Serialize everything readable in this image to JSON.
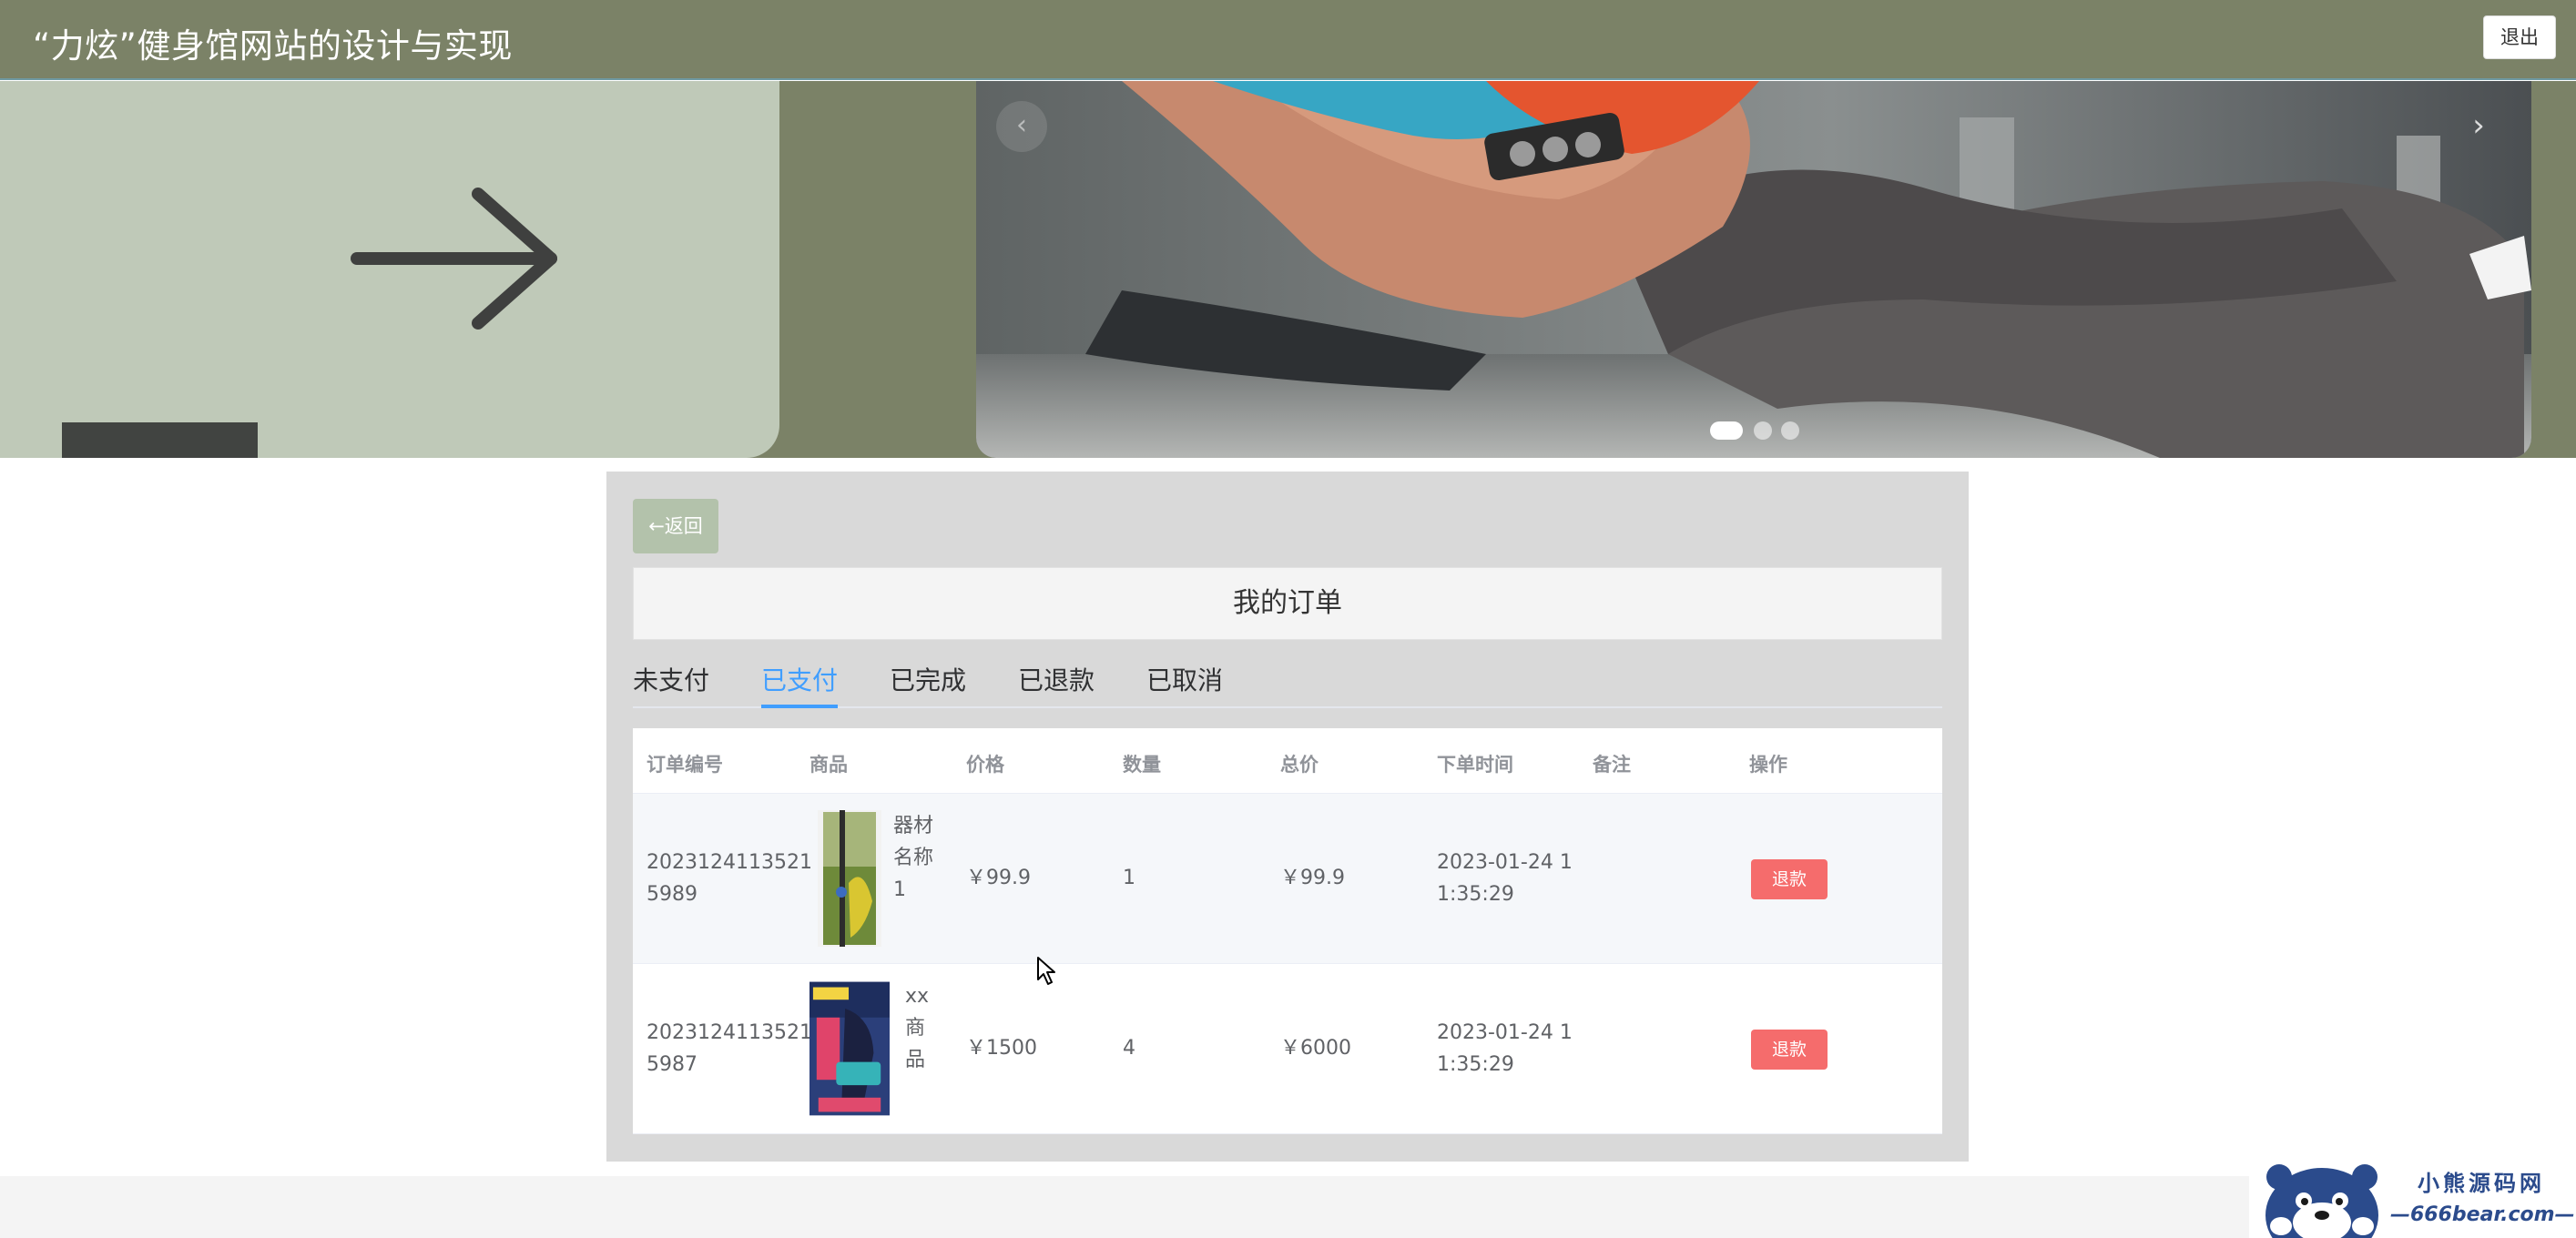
{
  "header": {
    "title": "“力炫”健身馆网站的设计与实现",
    "logout_label": "退出"
  },
  "banner": {
    "prev_icon": "‹",
    "next_icon": "›",
    "slide_count": 3,
    "active_slide": 1
  },
  "panel": {
    "back_label": "←返回",
    "title": "我的订单",
    "tabs": [
      {
        "label": "未支付",
        "active": false
      },
      {
        "label": "已支付",
        "active": true
      },
      {
        "label": "已完成",
        "active": false
      },
      {
        "label": "已退款",
        "active": false
      },
      {
        "label": "已取消",
        "active": false
      }
    ],
    "columns": [
      "订单编号",
      "商品",
      "价格",
      "数量",
      "总价",
      "下单时间",
      "备注",
      "操作"
    ],
    "orders": [
      {
        "id_line1": "2023124113521",
        "id_line2": "5989",
        "product_line1": "器材",
        "product_line2": "名称",
        "product_line3": "1",
        "price": "￥99.9",
        "qty": "1",
        "total": "￥99.9",
        "time_line1": "2023-01-24 1",
        "time_line2": "1:35:29",
        "note": "",
        "action": "退款"
      },
      {
        "id_line1": "2023124113521",
        "id_line2": "5987",
        "product_line1": "xx",
        "product_line2": "商",
        "product_line3": "品",
        "price": "￥1500",
        "qty": "4",
        "total": "￥6000",
        "time_line1": "2023-01-24 1",
        "time_line2": "1:35:29",
        "note": "",
        "action": "退款"
      }
    ]
  },
  "watermark": {
    "cn": "小熊源码网",
    "url": "—666bear.com—"
  },
  "colors": {
    "header_bg": "#7b8267",
    "tab_active": "#409eff",
    "refund": "#f56c6c",
    "back_button": "#b3c2ab"
  }
}
